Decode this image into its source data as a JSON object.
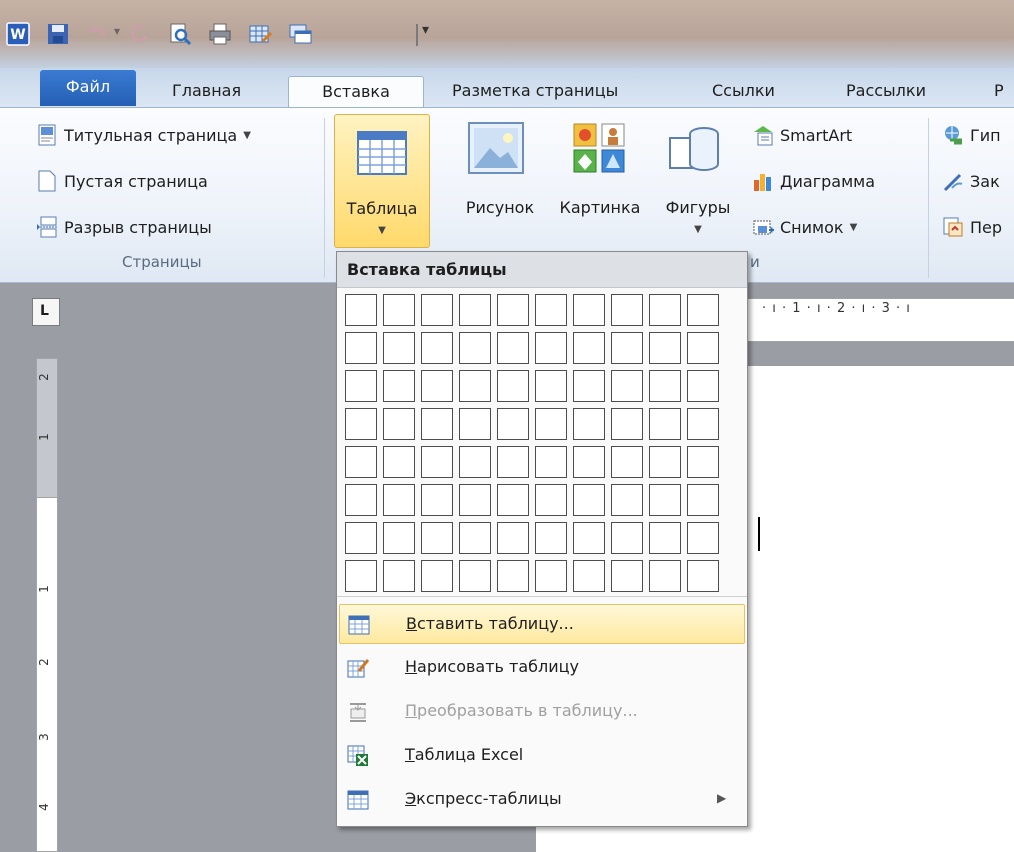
{
  "quick_access": {
    "icons": [
      "word-app-icon",
      "save-icon",
      "undo-icon",
      "redo-icon",
      "print-preview-icon",
      "print-icon",
      "table-icon",
      "window-icon"
    ],
    "more": "▾"
  },
  "tabs": [
    {
      "label": "Файл"
    },
    {
      "label": "Главная"
    },
    {
      "label": "Вставка"
    },
    {
      "label": "Разметка страницы"
    },
    {
      "label": "Ссылки"
    },
    {
      "label": "Рассылки"
    },
    {
      "label": "Р"
    }
  ],
  "ribbon": {
    "pages_group": {
      "items": [
        "Титульная страница",
        "Пустая страница",
        "Разрыв страницы"
      ],
      "label": "Страницы"
    },
    "table_button": {
      "label": "Таблица"
    },
    "illustrations": {
      "picture": "Рисунок",
      "clipart": "Картинка",
      "shapes": "Фигуры",
      "smartart": "SmartArt",
      "chart": "Диаграмма",
      "screenshot": "Снимок",
      "group_label_fragment": "и"
    },
    "links_group": {
      "hyperlink": "Гип",
      "bookmark": "Зак",
      "crossref": "Пер"
    }
  },
  "ruler": {
    "corner": "L",
    "horizontal_text": "· ı · 1 · ı · 2 · ı · 3 · ı",
    "vertical_numbers": [
      "2",
      "1",
      "1",
      "2",
      "3",
      "4"
    ]
  },
  "dropdown": {
    "header": "Вставка таблицы",
    "grid": {
      "rows": 8,
      "cols": 10
    },
    "items": [
      {
        "label": "Вставить таблицу...",
        "underline": "В",
        "rest": "ставить таблицу...",
        "highlighted": true,
        "disabled": false,
        "icon": "insert-table-icon"
      },
      {
        "label": "Нарисовать таблицу",
        "underline": "Н",
        "rest": "арисовать таблицу",
        "highlighted": false,
        "disabled": false,
        "icon": "draw-table-icon"
      },
      {
        "label": "Преобразовать в таблицу...",
        "underline": "П",
        "rest": "реобразовать в таблицу...",
        "highlighted": false,
        "disabled": true,
        "icon": "convert-table-icon"
      },
      {
        "label": "Таблица Excel",
        "underline": "Т",
        "rest": "аблица Excel",
        "highlighted": false,
        "disabled": false,
        "icon": "excel-table-icon"
      },
      {
        "label": "Экспресс-таблицы",
        "underline": "Э",
        "rest": "кспресс-таблицы",
        "highlighted": false,
        "disabled": false,
        "icon": "quick-tables-icon",
        "submenu": true
      }
    ]
  }
}
